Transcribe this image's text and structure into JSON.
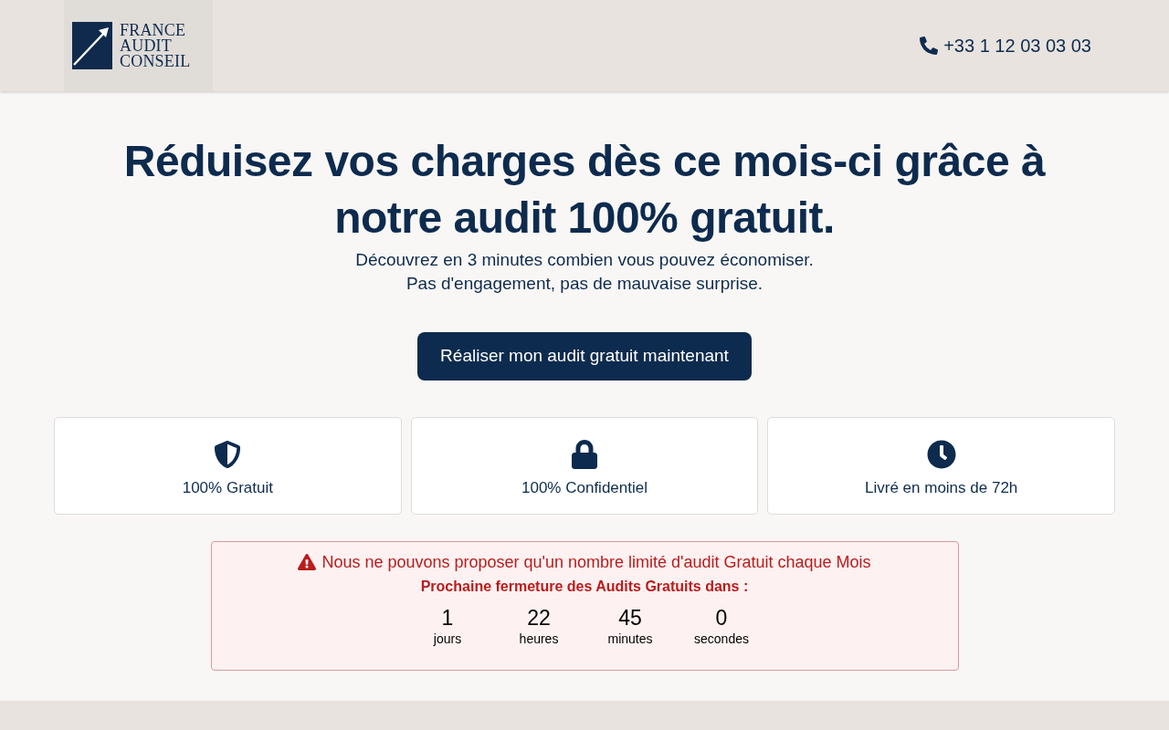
{
  "header": {
    "logo_lines": [
      "FRANCE",
      "AUDIT",
      "CONSEIL"
    ],
    "phone": "+33 1 12 03 03 03"
  },
  "hero": {
    "title": "Réduisez vos charges dès ce mois-ci grâce à notre audit 100% gratuit.",
    "subtitle_lines": [
      "Découvrez en 3 minutes combien vous pouvez économiser.",
      "Pas d'engagement, pas de mauvaise surprise."
    ],
    "cta": "Réaliser mon audit gratuit maintenant"
  },
  "features": [
    {
      "kind": "shield",
      "label": "100% Gratuit"
    },
    {
      "kind": "lock",
      "label": "100% Confidentiel"
    },
    {
      "kind": "clock",
      "label": "Livré en moins de 72h"
    }
  ],
  "alert": {
    "message": "Nous ne pouvons proposer qu'un nombre limité d'audit Gratuit chaque Mois",
    "heading": "Prochaine fermeture des Audits Gratuits dans :",
    "countdown": [
      {
        "value": "1",
        "unit": "jours"
      },
      {
        "value": "22",
        "unit": "heures"
      },
      {
        "value": "45",
        "unit": "minutes"
      },
      {
        "value": "0",
        "unit": "secondes"
      }
    ]
  }
}
